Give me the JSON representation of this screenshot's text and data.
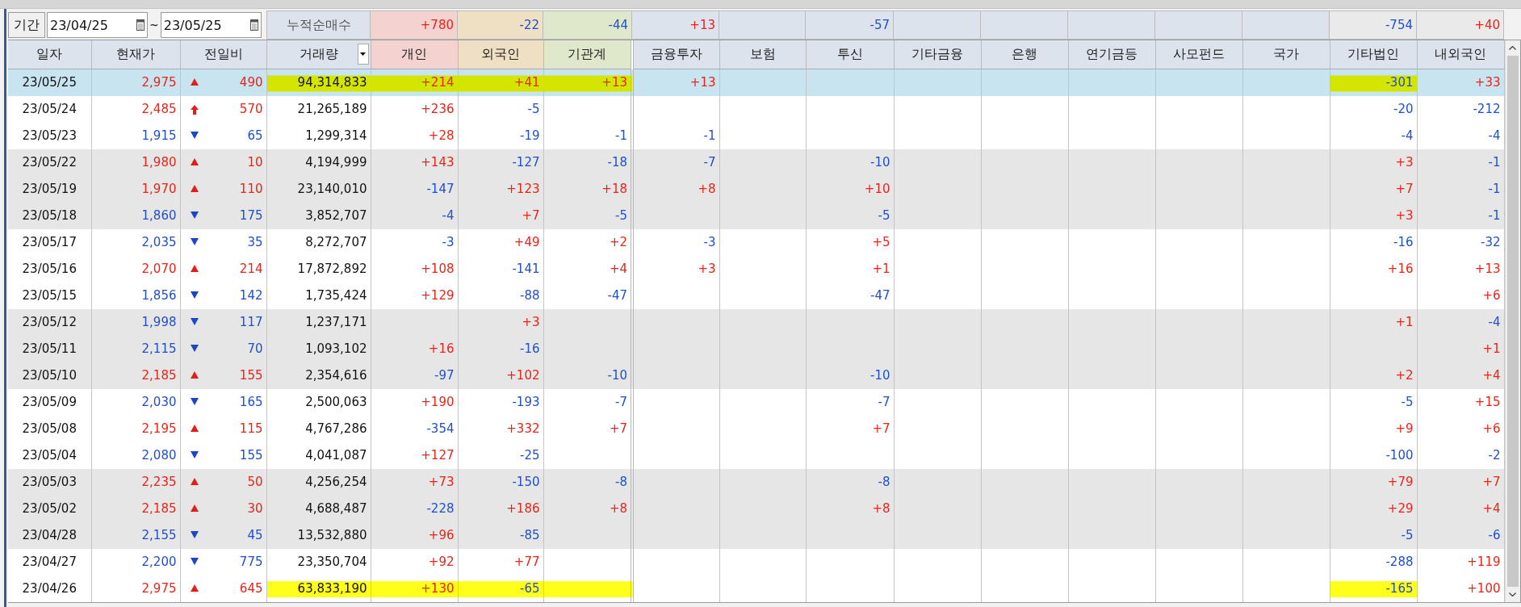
{
  "filter": {
    "label": "기간",
    "start_date": "23/04/25",
    "separator": "~",
    "end_date": "23/05/25"
  },
  "summary": {
    "label": "누적순매수",
    "cells": [
      {
        "value": "+780",
        "color": "#f4d2cf"
      },
      {
        "value": "-22",
        "color": "#efdfc3"
      },
      {
        "value": "-44",
        "color": "#e0e8cc"
      },
      {
        "value": "+13",
        "color": "#dce3ec"
      },
      {
        "color": "#dce3ec"
      },
      {
        "value": "-57",
        "color": "#dce3ec"
      },
      {
        "color": "#dce3ec"
      },
      {
        "color": "#dce3ec"
      },
      {
        "color": "#dce3ec"
      },
      {
        "color": "#dce3ec"
      },
      {
        "color": "#dce3ec"
      },
      {
        "value": "-754",
        "color": "#eaeaea"
      },
      {
        "value": "+40",
        "color": "#eaeaea"
      }
    ]
  },
  "columns": [
    {
      "label": "일자",
      "color": "#dce3ec",
      "dropdown": false
    },
    {
      "label": "현재가",
      "color": "#dce3ec",
      "dropdown": false
    },
    {
      "label": "전일비",
      "color": "#dce3ec",
      "dropdown": false
    },
    {
      "label": "거래량",
      "color": "#dce3ec",
      "dropdown": true
    },
    {
      "label": "개인",
      "color": "#f4d2cf",
      "dropdown": false
    },
    {
      "label": "외국인",
      "color": "#efdfc3",
      "dropdown": false
    },
    {
      "label": "기관계",
      "color": "#e0e8cc",
      "dropdown": false
    },
    {
      "label": "금융투자",
      "color": "#dce3ec",
      "dropdown": false
    },
    {
      "label": "보험",
      "color": "#dce3ec",
      "dropdown": false
    },
    {
      "label": "투신",
      "color": "#dce3ec",
      "dropdown": false
    },
    {
      "label": "기타금융",
      "color": "#dce3ec",
      "dropdown": false
    },
    {
      "label": "은행",
      "color": "#dce3ec",
      "dropdown": false
    },
    {
      "label": "연기금등",
      "color": "#dce3ec",
      "dropdown": false
    },
    {
      "label": "사모펀드",
      "color": "#dce3ec",
      "dropdown": false
    },
    {
      "label": "국가",
      "color": "#dce3ec",
      "dropdown": false
    },
    {
      "label": "기타법인",
      "color": "#dce3ec",
      "dropdown": false
    },
    {
      "label": "내외국인",
      "color": "#dce3ec",
      "dropdown": false
    }
  ],
  "rows": [
    {
      "date": "23/05/25",
      "price": "2,975",
      "up": true,
      "limit": false,
      "change": "490",
      "volume": "94,314,833",
      "flows": {
        "individual": "+214",
        "foreign": "+41",
        "institution": "+13",
        "financial_investment": "+13",
        "other_corp": "-301",
        "domestic_foreign": "+33"
      },
      "selected": true,
      "marker": {
        "color": "#d4e600"
      },
      "marked": {
        "volume": true,
        "individual": true,
        "foreign": true,
        "institution": true,
        "other_corp": true
      }
    },
    {
      "date": "23/05/24",
      "price": "2,485",
      "up": true,
      "limit": true,
      "change": "570",
      "volume": "21,265,189",
      "flows": {
        "individual": "+236",
        "foreign": "-5",
        "other_corp": "-20",
        "domestic_foreign": "-212"
      },
      "selected": false,
      "shaded": false
    },
    {
      "date": "23/05/23",
      "price": "1,915",
      "up": false,
      "limit": false,
      "change": "65",
      "volume": "1,299,314",
      "flows": {
        "individual": "+28",
        "foreign": "-19",
        "institution": "-1",
        "financial_investment": "-1",
        "other_corp": "-4",
        "domestic_foreign": "-4"
      },
      "selected": false,
      "shaded": false
    },
    {
      "date": "23/05/22",
      "price": "1,980",
      "up": true,
      "limit": false,
      "change": "10",
      "volume": "4,194,999",
      "flows": {
        "individual": "+143",
        "foreign": "-127",
        "institution": "-18",
        "financial_investment": "-7",
        "investment_trust": "-10",
        "other_corp": "+3",
        "domestic_foreign": "-1"
      },
      "selected": false,
      "shaded": true
    },
    {
      "date": "23/05/19",
      "price": "1,970",
      "up": true,
      "limit": false,
      "change": "110",
      "volume": "23,140,010",
      "flows": {
        "individual": "-147",
        "foreign": "+123",
        "institution": "+18",
        "financial_investment": "+8",
        "investment_trust": "+10",
        "other_corp": "+7",
        "domestic_foreign": "-1"
      },
      "selected": false,
      "shaded": true
    },
    {
      "date": "23/05/18",
      "price": "1,860",
      "up": false,
      "limit": false,
      "change": "175",
      "volume": "3,852,707",
      "flows": {
        "individual": "-4",
        "foreign": "+7",
        "institution": "-5",
        "investment_trust": "-5",
        "other_corp": "+3",
        "domestic_foreign": "-1"
      },
      "selected": false,
      "shaded": true
    },
    {
      "date": "23/05/17",
      "price": "2,035",
      "up": false,
      "limit": false,
      "change": "35",
      "volume": "8,272,707",
      "flows": {
        "individual": "-3",
        "foreign": "+49",
        "institution": "+2",
        "financial_investment": "-3",
        "investment_trust": "+5",
        "other_corp": "-16",
        "domestic_foreign": "-32"
      },
      "selected": false,
      "shaded": false
    },
    {
      "date": "23/05/16",
      "price": "2,070",
      "up": true,
      "limit": false,
      "change": "214",
      "volume": "17,872,892",
      "flows": {
        "individual": "+108",
        "foreign": "-141",
        "institution": "+4",
        "financial_investment": "+3",
        "investment_trust": "+1",
        "other_corp": "+16",
        "domestic_foreign": "+13"
      },
      "selected": false,
      "shaded": false
    },
    {
      "date": "23/05/15",
      "price": "1,856",
      "up": false,
      "limit": false,
      "change": "142",
      "volume": "1,735,424",
      "flows": {
        "individual": "+129",
        "foreign": "-88",
        "institution": "-47",
        "investment_trust": "-47",
        "domestic_foreign": "+6"
      },
      "selected": false,
      "shaded": false
    },
    {
      "date": "23/05/12",
      "price": "1,998",
      "up": false,
      "limit": false,
      "change": "117",
      "volume": "1,237,171",
      "flows": {
        "foreign": "+3",
        "other_corp": "+1",
        "domestic_foreign": "-4"
      },
      "selected": false,
      "shaded": true
    },
    {
      "date": "23/05/11",
      "price": "2,115",
      "up": false,
      "limit": false,
      "change": "70",
      "volume": "1,093,102",
      "flows": {
        "individual": "+16",
        "foreign": "-16",
        "domestic_foreign": "+1"
      },
      "selected": false,
      "shaded": true
    },
    {
      "date": "23/05/10",
      "price": "2,185",
      "up": true,
      "limit": false,
      "change": "155",
      "volume": "2,354,616",
      "flows": {
        "individual": "-97",
        "foreign": "+102",
        "institution": "-10",
        "investment_trust": "-10",
        "other_corp": "+2",
        "domestic_foreign": "+4"
      },
      "selected": false,
      "shaded": true
    },
    {
      "date": "23/05/09",
      "price": "2,030",
      "up": false,
      "limit": false,
      "change": "165",
      "volume": "2,500,063",
      "flows": {
        "individual": "+190",
        "foreign": "-193",
        "institution": "-7",
        "investment_trust": "-7",
        "other_corp": "-5",
        "domestic_foreign": "+15"
      },
      "selected": false,
      "shaded": false
    },
    {
      "date": "23/05/08",
      "price": "2,195",
      "up": true,
      "limit": false,
      "change": "115",
      "volume": "4,767,286",
      "flows": {
        "individual": "-354",
        "foreign": "+332",
        "institution": "+7",
        "investment_trust": "+7",
        "other_corp": "+9",
        "domestic_foreign": "+6"
      },
      "selected": false,
      "shaded": false
    },
    {
      "date": "23/05/04",
      "price": "2,080",
      "up": false,
      "limit": false,
      "change": "155",
      "volume": "4,041,087",
      "flows": {
        "individual": "+127",
        "foreign": "-25",
        "other_corp": "-100",
        "domestic_foreign": "-2"
      },
      "selected": false,
      "shaded": false
    },
    {
      "date": "23/05/03",
      "price": "2,235",
      "up": true,
      "limit": false,
      "change": "50",
      "volume": "4,256,254",
      "flows": {
        "individual": "+73",
        "foreign": "-150",
        "institution": "-8",
        "investment_trust": "-8",
        "other_corp": "+79",
        "domestic_foreign": "+7"
      },
      "selected": false,
      "shaded": true
    },
    {
      "date": "23/05/02",
      "price": "2,185",
      "up": true,
      "limit": false,
      "change": "30",
      "volume": "4,688,487",
      "flows": {
        "individual": "-228",
        "foreign": "+186",
        "institution": "+8",
        "investment_trust": "+8",
        "other_corp": "+29",
        "domestic_foreign": "+4"
      },
      "selected": false,
      "shaded": true
    },
    {
      "date": "23/04/28",
      "price": "2,155",
      "up": false,
      "limit": false,
      "change": "45",
      "volume": "13,532,880",
      "flows": {
        "individual": "+96",
        "foreign": "-85",
        "other_corp": "-5",
        "domestic_foreign": "-6"
      },
      "selected": false,
      "shaded": true
    },
    {
      "date": "23/04/27",
      "price": "2,200",
      "up": false,
      "limit": false,
      "change": "775",
      "volume": "23,350,704",
      "flows": {
        "individual": "+92",
        "foreign": "+77",
        "other_corp": "-288",
        "domestic_foreign": "+119"
      },
      "selected": false,
      "shaded": false
    },
    {
      "date": "23/04/26",
      "price": "2,975",
      "up": true,
      "limit": false,
      "change": "645",
      "volume": "63,833,190",
      "flows": {
        "individual": "+130",
        "foreign": "-65",
        "other_corp": "-165",
        "domestic_foreign": "+100"
      },
      "selected": false,
      "shaded": false,
      "marker": {
        "color": "#ffff1a"
      },
      "marked": {
        "volume": true,
        "individual": true,
        "foreign": true,
        "institution": true,
        "other_corp": true
      }
    }
  ]
}
